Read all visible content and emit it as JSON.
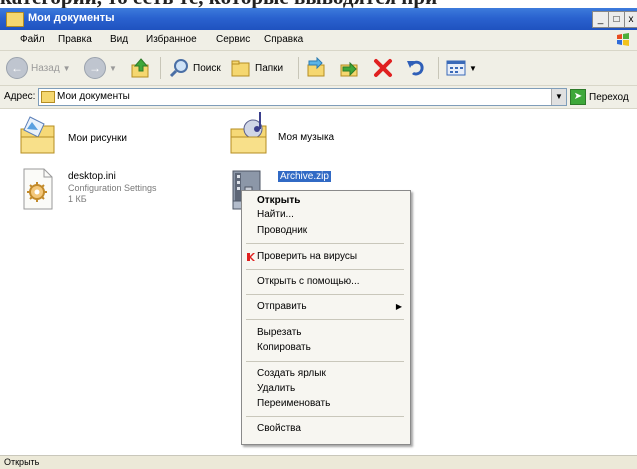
{
  "background_text": "категорий, то есть те, которые выводятся при",
  "window": {
    "title": "Мои документы",
    "minimize": "_",
    "maximize": "□",
    "close": "x"
  },
  "menu": [
    "Файл",
    "Правка",
    "Вид",
    "Избранное",
    "Сервис",
    "Справка"
  ],
  "toolbar": {
    "back": "Назад",
    "search": "Поиск",
    "folders": "Папки"
  },
  "address": {
    "label": "Адрес:",
    "value": "Мои документы",
    "go": "Переход"
  },
  "files": [
    {
      "name": "Мои рисунки",
      "icon": "pictures-folder-icon"
    },
    {
      "name": "Моя музыка",
      "icon": "music-folder-icon"
    },
    {
      "name": "desktop.ini",
      "line2": "Configuration Settings",
      "line3": "1 КБ",
      "icon": "settings-file-icon"
    },
    {
      "name": "Archive.zip",
      "icon": "zip-archive-icon",
      "selected": true
    }
  ],
  "context_menu": {
    "open": "Открыть",
    "find": "Найти...",
    "explorer": "Проводник",
    "scan": "Проверить на вирусы",
    "open_with": "Открыть с помощью...",
    "send_to": "Отправить",
    "cut": "Вырезать",
    "copy": "Копировать",
    "create_shortcut": "Создать ярлык",
    "delete": "Удалить",
    "rename": "Переименовать",
    "properties": "Свойства"
  },
  "status": "Открыть",
  "colors": {
    "titlebar": "#2a62cf",
    "selection": "#316ac5",
    "delete_red": "#e02020",
    "go_green": "#3ea83a"
  }
}
